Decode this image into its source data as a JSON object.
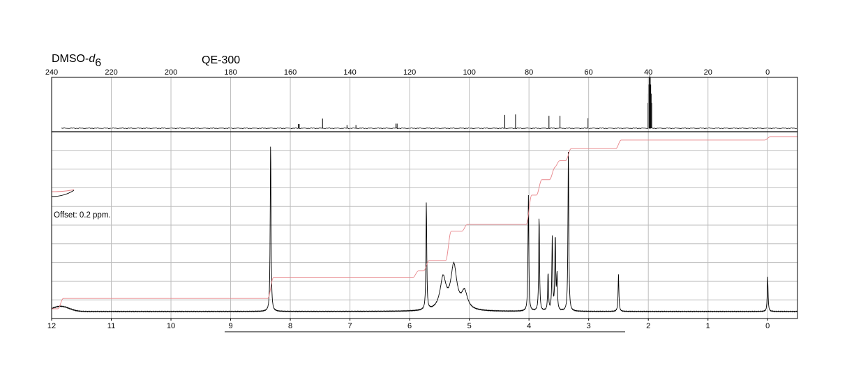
{
  "header": {
    "solvent_prefix": "DMSO-",
    "solvent_italic": "d",
    "solvent_subscript": "6",
    "instrument": "QE-300"
  },
  "offset_note": "Offset: 0.2 ppm.",
  "colors": {
    "spectrum": "#000000",
    "integral": "#e8868b",
    "grid": "#bdbdbd",
    "frame": "#000000"
  },
  "chart_data": [
    {
      "type": "line",
      "name": "13C",
      "xlim": [
        240,
        -10
      ],
      "reversed_x": true,
      "x_ticks": [
        240,
        220,
        200,
        180,
        160,
        140,
        120,
        100,
        80,
        60,
        40,
        20,
        0
      ],
      "peaks_ppm": [
        157.3,
        157.0,
        149.2,
        141.0,
        138.0,
        124.6,
        124.2,
        88.1,
        84.5,
        73.3,
        69.6,
        60.2
      ],
      "peak_heights_rel": [
        0.09,
        0.09,
        0.21,
        0.07,
        0.07,
        0.1,
        0.1,
        0.29,
        0.3,
        0.27,
        0.27,
        0.22
      ],
      "solvent_multiplet_ppm": 39.5
    },
    {
      "type": "line",
      "name": "1H",
      "xlim": [
        12,
        -0.5
      ],
      "reversed_x": true,
      "x_ticks": [
        12,
        11,
        10,
        9,
        8,
        7,
        6,
        5,
        4,
        3,
        2,
        1,
        0
      ],
      "grid": true,
      "peaks": [
        {
          "ppm": 8.33,
          "height": 0.98
        },
        {
          "ppm": 5.72,
          "height": 0.62
        },
        {
          "ppm": 5.44,
          "height": 0.18
        },
        {
          "ppm": 5.26,
          "height": 0.25
        },
        {
          "ppm": 5.08,
          "height": 0.1
        },
        {
          "ppm": 4.01,
          "height": 0.66
        },
        {
          "ppm": 3.83,
          "height": 0.55
        },
        {
          "ppm": 3.68,
          "height": 0.22
        },
        {
          "ppm": 3.61,
          "height": 0.42
        },
        {
          "ppm": 3.56,
          "height": 0.43
        },
        {
          "ppm": 3.53,
          "height": 0.2
        },
        {
          "ppm": 3.34,
          "height": 0.93
        },
        {
          "ppm": 2.5,
          "height": 0.21
        },
        {
          "ppm": 0.0,
          "height": 0.2
        }
      ],
      "offset_peak": {
        "ppm": 11.85,
        "height": 0.03
      },
      "integral_steps": [
        {
          "ppm": 11.85,
          "level": 0.06
        },
        {
          "ppm": 8.33,
          "level": 0.18
        },
        {
          "ppm": 5.9,
          "level": 0.22
        },
        {
          "ppm": 5.72,
          "level": 0.28
        },
        {
          "ppm": 5.35,
          "level": 0.45
        },
        {
          "ppm": 5.08,
          "level": 0.49
        },
        {
          "ppm": 4.0,
          "level": 0.66
        },
        {
          "ppm": 3.83,
          "level": 0.75
        },
        {
          "ppm": 3.61,
          "level": 0.82
        },
        {
          "ppm": 3.53,
          "level": 0.86
        },
        {
          "ppm": 3.34,
          "level": 0.93
        },
        {
          "ppm": 2.5,
          "level": 0.98
        },
        {
          "ppm": 0.0,
          "level": 1.0
        }
      ]
    }
  ]
}
